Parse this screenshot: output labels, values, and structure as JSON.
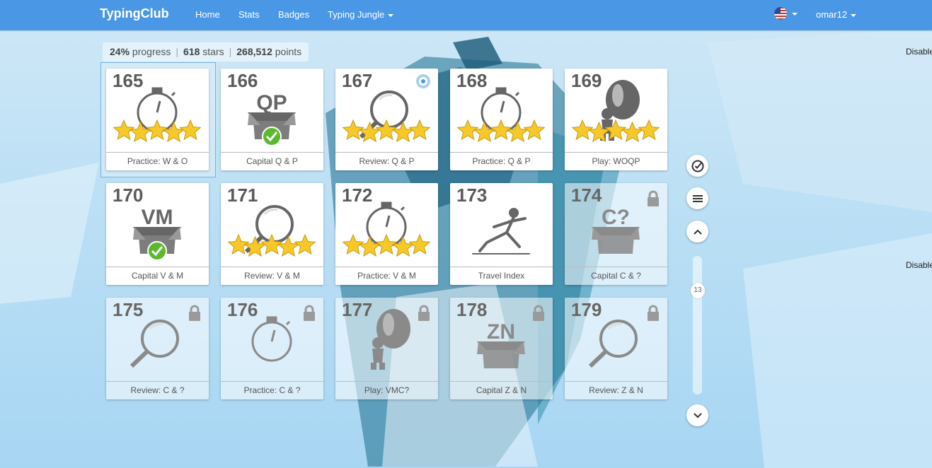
{
  "navbar": {
    "brand": "TypingClub",
    "links": [
      "Home",
      "Stats",
      "Badges",
      "Typing Jungle"
    ],
    "user": "omar12",
    "flag_icon": "us-flag-icon"
  },
  "stats": {
    "progress": "24%",
    "progress_label": "progress",
    "stars": "618",
    "stars_label": "stars",
    "points": "268,512",
    "points_label": "points"
  },
  "disable_labels": [
    "Disable",
    "Disable"
  ],
  "lessons": [
    {
      "num": "165",
      "label": "Practice: W & O",
      "icon": "stopwatch-icon",
      "stars": 5,
      "locked": false
    },
    {
      "num": "166",
      "label": "Capital Q & P",
      "icon": "box-icon",
      "letters": "QP",
      "completed": true,
      "locked": false
    },
    {
      "num": "167",
      "label": "Review: Q & P",
      "icon": "magnifier-icon",
      "stars": 5,
      "badge": "badge-icon",
      "locked": false
    },
    {
      "num": "168",
      "label": "Practice: Q & P",
      "icon": "stopwatch-icon",
      "stars": 5,
      "locked": false
    },
    {
      "num": "169",
      "label": "Play: WOQP",
      "icon": "balloon-icon",
      "stars": 5,
      "locked": false
    },
    {
      "num": "170",
      "label": "Capital V & M",
      "icon": "box-icon",
      "letters": "VM",
      "completed": true,
      "locked": false
    },
    {
      "num": "171",
      "label": "Review: V & M",
      "icon": "magnifier-icon",
      "stars": 5,
      "locked": false
    },
    {
      "num": "172",
      "label": "Practice: V & M",
      "icon": "stopwatch-icon",
      "stars": 5,
      "locked": false
    },
    {
      "num": "173",
      "label": "Travel Index",
      "icon": "lunge-figure-icon",
      "locked": false
    },
    {
      "num": "174",
      "label": "Capital C & ?",
      "icon": "box-icon",
      "letters": "C?",
      "locked": true
    },
    {
      "num": "175",
      "label": "Review: C & ?",
      "icon": "magnifier-icon",
      "locked": true
    },
    {
      "num": "176",
      "label": "Practice: C & ?",
      "icon": "stopwatch-icon",
      "locked": true
    },
    {
      "num": "177",
      "label": "Play: VMC?",
      "icon": "balloon-icon",
      "locked": true
    },
    {
      "num": "178",
      "label": "Capital Z & N",
      "icon": "box-icon",
      "letters": "ZN",
      "locked": true
    },
    {
      "num": "179",
      "label": "Review: Z & N",
      "icon": "magnifier-icon",
      "locked": true
    }
  ],
  "side_controls": {
    "check_icon": "check-circle-icon",
    "menu_icon": "menu-icon",
    "up_icon": "chevron-up-icon",
    "down_icon": "chevron-down-icon",
    "page": "13"
  },
  "colors": {
    "navbar": "#4a97e6",
    "star": "#f7c928",
    "check": "#5cb82c",
    "icon_gray": "#666666"
  }
}
